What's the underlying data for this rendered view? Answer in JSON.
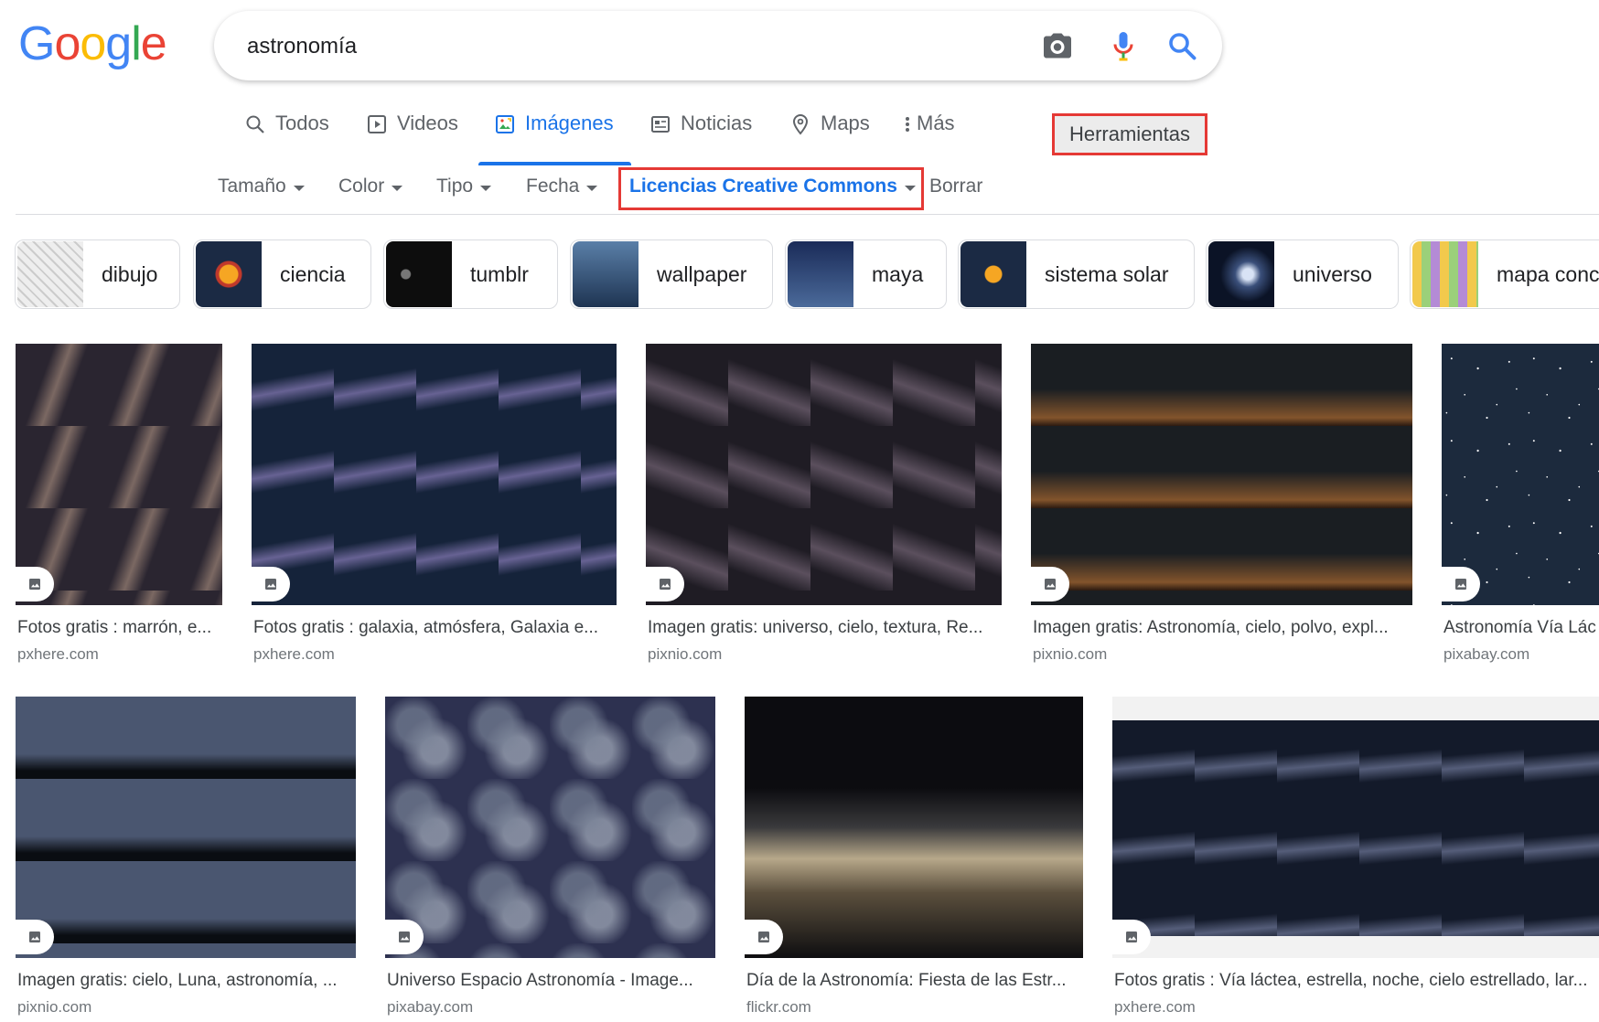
{
  "logo": {
    "letters": [
      "G",
      "o",
      "o",
      "g",
      "l",
      "e"
    ],
    "colors": [
      "#4285f4",
      "#ea4335",
      "#fbbc05",
      "#4285f4",
      "#34a853",
      "#ea4335"
    ]
  },
  "search": {
    "query": "astronomía",
    "icons": [
      "camera-icon",
      "mic-icon",
      "search-icon"
    ]
  },
  "tabs": [
    {
      "label": "Todos",
      "icon": "search-icon"
    },
    {
      "label": "Videos",
      "icon": "play-icon"
    },
    {
      "label": "Imágenes",
      "icon": "image-icon",
      "active": true
    },
    {
      "label": "Noticias",
      "icon": "news-icon"
    },
    {
      "label": "Maps",
      "icon": "map-pin-icon"
    },
    {
      "label": "Más",
      "icon": "more-vert-icon"
    }
  ],
  "tools_label": "Herramientas",
  "filters": [
    {
      "label": "Tamaño"
    },
    {
      "label": "Color"
    },
    {
      "label": "Tipo"
    },
    {
      "label": "Fecha"
    },
    {
      "label": "Licencias Creative Commons",
      "active": true
    }
  ],
  "clear_label": "Borrar",
  "chips": [
    "dibujo",
    "ciencia",
    "tumblr",
    "wallpaper",
    "maya",
    "sistema solar",
    "universo",
    "mapa conc"
  ],
  "results": [
    {
      "title": "Fotos gratis : marrón, e...",
      "source": "pxhere.com"
    },
    {
      "title": "Fotos gratis : galaxia, atmósfera, Galaxia e...",
      "source": "pxhere.com"
    },
    {
      "title": "Imagen gratis: universo, cielo, textura, Re...",
      "source": "pixnio.com"
    },
    {
      "title": "Imagen gratis: Astronomía, cielo, polvo, expl...",
      "source": "pixnio.com"
    },
    {
      "title": "Astronomía Vía Lác",
      "source": "pixabay.com"
    },
    {
      "title": "Imagen gratis: cielo, Luna, astronomía, ...",
      "source": "pixnio.com"
    },
    {
      "title": "Universo Espacio Astronomía - Image...",
      "source": "pixabay.com"
    },
    {
      "title": "Día de la Astronomía: Fiesta de las Estr...",
      "source": "flickr.com"
    },
    {
      "title": "Fotos gratis : Vía láctea, estrella, noche, cielo estrellado, lar...",
      "source": "pxhere.com"
    }
  ],
  "colors": {
    "accent": "#1a73e8",
    "highlight_border": "#e53935",
    "muted_text": "#5f6368"
  }
}
